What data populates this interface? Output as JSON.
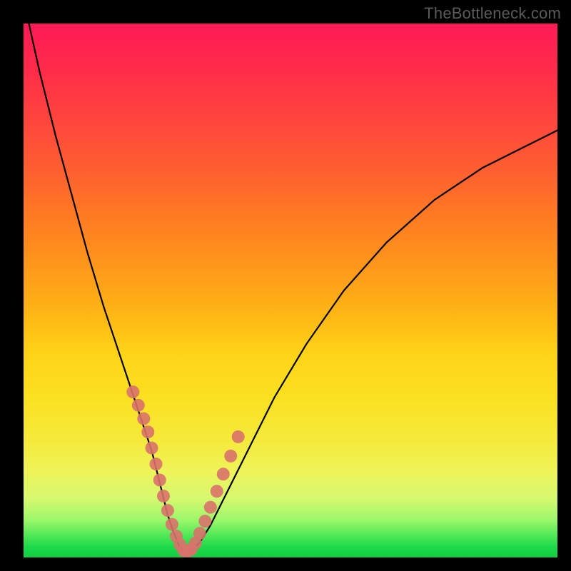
{
  "watermark": "TheBottleneck.com",
  "chart_data": {
    "type": "line",
    "title": "",
    "xlabel": "",
    "ylabel": "",
    "xlim": [
      0,
      100
    ],
    "ylim": [
      0,
      100
    ],
    "series": [
      {
        "name": "bottleneck-curve",
        "x": [
          1,
          3,
          6,
          9,
          12,
          15,
          18,
          20,
          22,
          24,
          25,
          26,
          27,
          28,
          29,
          29.7,
          30.5,
          31.5,
          33,
          35,
          38,
          42,
          47,
          53,
          60,
          68,
          77,
          86,
          94,
          100
        ],
        "values": [
          100,
          91,
          79,
          68,
          57,
          47,
          38,
          32,
          26,
          20,
          16,
          12,
          8,
          5,
          2.5,
          1.2,
          1.0,
          1.3,
          2.8,
          6,
          12,
          20,
          30,
          40,
          50,
          59,
          67,
          73,
          77,
          80
        ]
      }
    ],
    "markers": {
      "name": "highlight-points",
      "color": "#d9726b",
      "radius_px": 9,
      "x": [
        20.5,
        21.5,
        22.5,
        23.3,
        24.0,
        24.8,
        25.5,
        26.2,
        27.0,
        27.8,
        28.6,
        29.3,
        30.0,
        30.7,
        31.4,
        32.2,
        33.0,
        34.0,
        35.0,
        36.2,
        37.4,
        38.8,
        40.2
      ],
      "values": [
        31,
        28.5,
        26,
        23.5,
        20.5,
        17.5,
        14.5,
        11.5,
        8.8,
        6.2,
        4.0,
        2.4,
        1.3,
        1.1,
        1.5,
        2.7,
        4.5,
        6.8,
        9.4,
        12.4,
        15.6,
        19.0,
        22.6
      ]
    },
    "background_gradient": {
      "stops": [
        {
          "pos": 0.0,
          "color": "#ff1a55"
        },
        {
          "pos": 0.26,
          "color": "#ff5a33"
        },
        {
          "pos": 0.55,
          "color": "#ffb814"
        },
        {
          "pos": 0.78,
          "color": "#f5ea3a"
        },
        {
          "pos": 0.93,
          "color": "#9cf76a"
        },
        {
          "pos": 1.0,
          "color": "#0ecf44"
        }
      ]
    }
  }
}
